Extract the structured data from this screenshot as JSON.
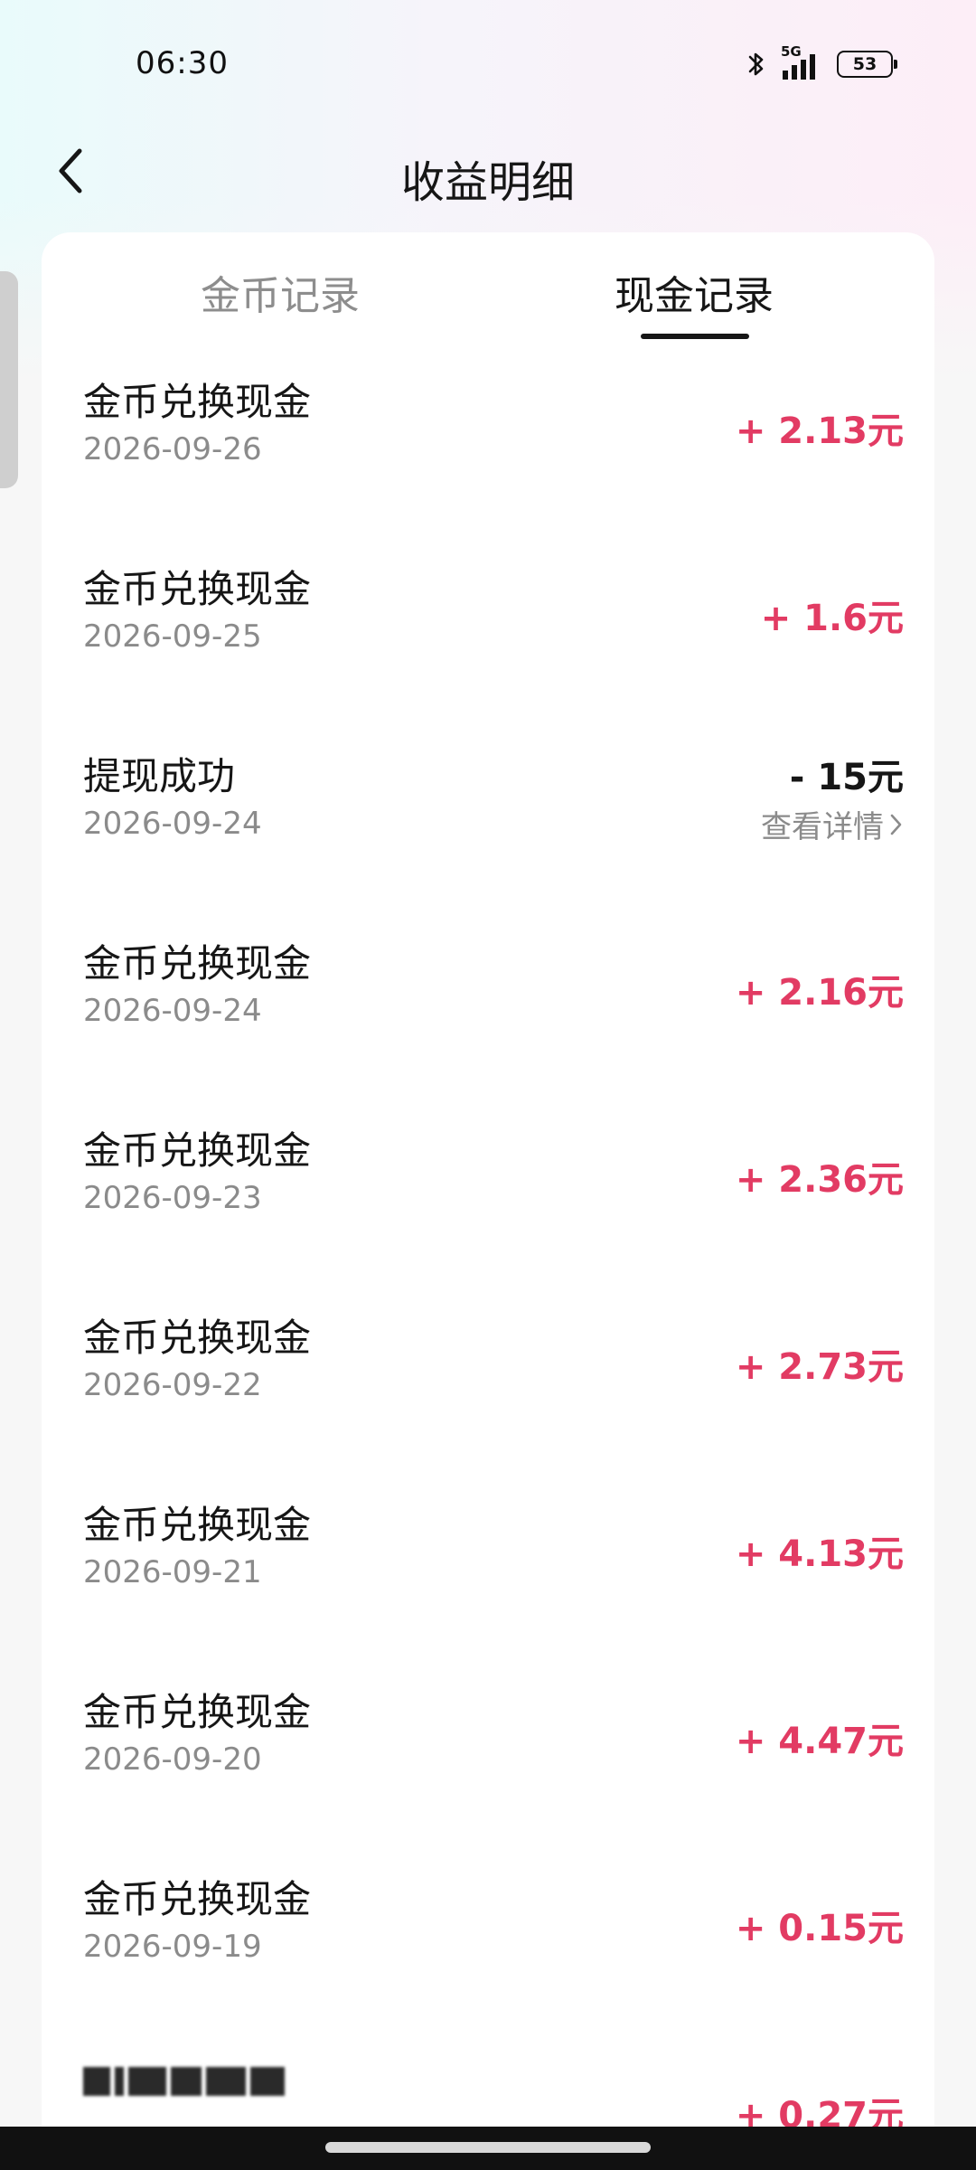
{
  "status_bar": {
    "time": "06:30",
    "network": "5G",
    "battery": "53"
  },
  "header": {
    "title": "收益明细"
  },
  "tabs": [
    {
      "label": "金币记录",
      "active": false
    },
    {
      "label": "现金记录",
      "active": true
    }
  ],
  "records": [
    {
      "title": "金币兑换现金",
      "date": "2026-09-26",
      "amount": "+ 2.13元"
    },
    {
      "title": "金币兑换现金",
      "date": "2026-09-25",
      "amount": "+ 1.6元"
    },
    {
      "title": "提现成功",
      "date": "2026-09-24",
      "amount": "- 15元",
      "detail_link": "查看详情"
    },
    {
      "title": "金币兑换现金",
      "date": "2026-09-24",
      "amount": "+ 2.16元"
    },
    {
      "title": "金币兑换现金",
      "date": "2026-09-23",
      "amount": "+ 2.36元"
    },
    {
      "title": "金币兑换现金",
      "date": "2026-09-22",
      "amount": "+ 2.73元"
    },
    {
      "title": "金币兑换现金",
      "date": "2026-09-21",
      "amount": "+ 4.13元"
    },
    {
      "title": "金币兑换现金",
      "date": "2026-09-20",
      "amount": "+ 4.47元"
    },
    {
      "title": "金币兑换现金",
      "date": "2026-09-19",
      "amount": "+ 0.15元"
    },
    {
      "amount": "+ 0.27元"
    }
  ],
  "colors": {
    "income": "#e23b63",
    "expense": "#161616",
    "secondary_text": "#8b8b8b"
  },
  "icons": {
    "back": "chevron-left-icon",
    "bluetooth": "bluetooth-icon",
    "signal": "signal-icon",
    "battery": "battery-icon",
    "detail": "chevron-right-icon"
  }
}
